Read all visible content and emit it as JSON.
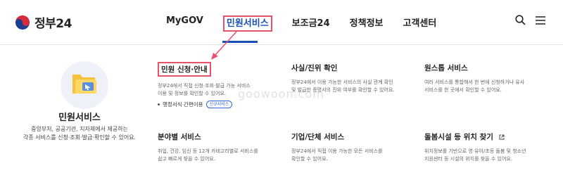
{
  "header": {
    "logo_text": "정부24",
    "nav": [
      "MyGOV",
      "민원서비스",
      "보조금24",
      "정책정보",
      "고객센터"
    ],
    "active_nav": "민원서비스"
  },
  "panel": {
    "title": "민원서비스",
    "desc_line1": "중앙부처, 공공기관, 지자체에서 제공하는",
    "desc_line2": "각종 서비스를 신청·조회·발급·확인할 수 있어요."
  },
  "cards": [
    {
      "title": "민원 신청·안내",
      "desc1": "정부24에서 직접 신청·조회·발급 가능 서비스",
      "desc2": "이용 및 정보를 확인할 수 있어요."
    },
    {
      "title": "사실/진위 확인",
      "desc1": "정부24에서 이용 가능한 서비스의 사실 관계 확인",
      "desc2": "및 발급한 증명서의 진위 여부를 확인할 수 있어요."
    },
    {
      "title": "원스톱 서비스",
      "desc1": "여러 서비스를 통합해서 한 번에 신청하거나 유사",
      "desc2": "서비스를 한 곳에서 확인할 수 있어요."
    },
    {
      "title": "분야별 서비스",
      "desc1": "취업, 건강, 임신 등 12개 카테고리별로 서비스를",
      "desc2": "쉽고 빠르게 찾을 수 있어요."
    },
    {
      "title": "기업/단체 서비스",
      "desc1": "정부24에서 직접 이용 가능한 모든 서비스를",
      "desc2": "확인할 수 있어요."
    },
    {
      "title": "돌봄시설 등 위치 찾기",
      "desc1": "위치정보를 기반으로 영·유아/초등 돌봄 및 청소년",
      "desc2": "지원센터 등 시설의 위치를 찾을 수 있어요."
    }
  ],
  "extra": {
    "label": "행정서식 간편이용",
    "tag": "신규서비스"
  },
  "watermark": "goowoon.com",
  "colors": {
    "accent": "#1a4fb5",
    "highlight": "#e8536b"
  }
}
